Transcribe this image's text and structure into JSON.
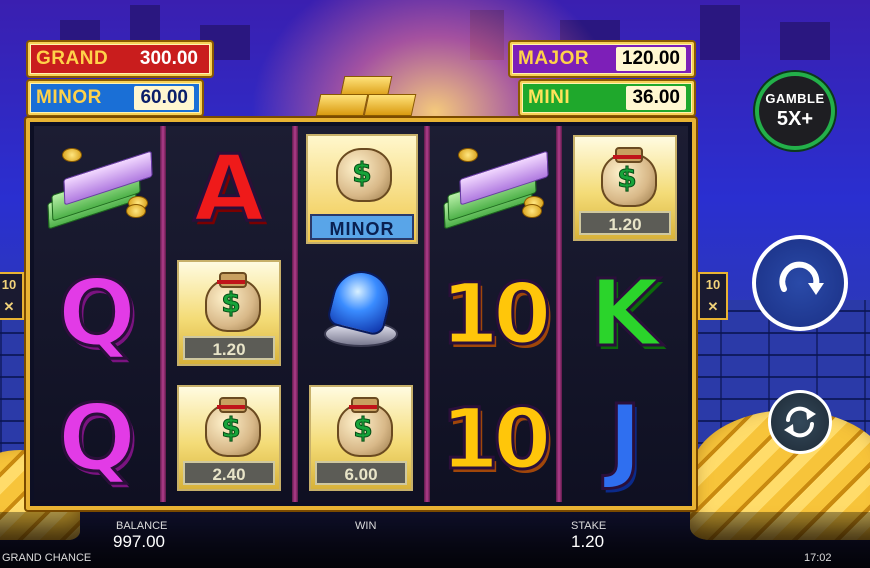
{
  "jackpots": {
    "grand": {
      "name": "GRAND",
      "value": "300.00"
    },
    "major": {
      "name": "MAJOR",
      "value": "120.00"
    },
    "minor": {
      "name": "MINOR",
      "value": "60.00"
    },
    "mini": {
      "name": "MINI",
      "value": "36.00"
    }
  },
  "reels": [
    [
      {
        "symbol": "cash-stack-icon"
      },
      {
        "symbol": "Q"
      },
      {
        "symbol": "Q"
      }
    ],
    [
      {
        "symbol": "A"
      },
      {
        "symbol": "money-bag",
        "value": "1.20"
      },
      {
        "symbol": "money-bag",
        "value": "2.40"
      }
    ],
    [
      {
        "symbol": "minor-bag",
        "label": "MINOR"
      },
      {
        "symbol": "police-light-icon"
      },
      {
        "symbol": "money-bag",
        "value": "6.00"
      }
    ],
    [
      {
        "symbol": "cash-stack-icon"
      },
      {
        "symbol": "10"
      },
      {
        "symbol": "10"
      }
    ],
    [
      {
        "symbol": "money-bag",
        "value": "1.20"
      },
      {
        "symbol": "K"
      },
      {
        "symbol": "J"
      }
    ]
  ],
  "side_badges": {
    "left": "10\n✕",
    "right": "10\n✕"
  },
  "controls": {
    "gamble_line1": "GAMBLE",
    "gamble_line2": "5X+",
    "spin_icon": "refresh-arrow-icon",
    "autoplay_icon": "autoplay-arrows-icon"
  },
  "footer": {
    "balance_label": "BALANCE",
    "balance_value": "997.00",
    "win_label": "WIN",
    "stake_label": "STAKE",
    "stake_value": "1.20",
    "game_title": "GRAND CHANCE",
    "clock": "17:02"
  },
  "colors": {
    "frame_gold": "#e8b333",
    "gamble_ring": "#23b04a",
    "grand_bg": "#c91d1d",
    "major_bg": "#7d1fb8",
    "minor_bg": "#1a6fd6",
    "mini_bg": "#1fa82c"
  }
}
